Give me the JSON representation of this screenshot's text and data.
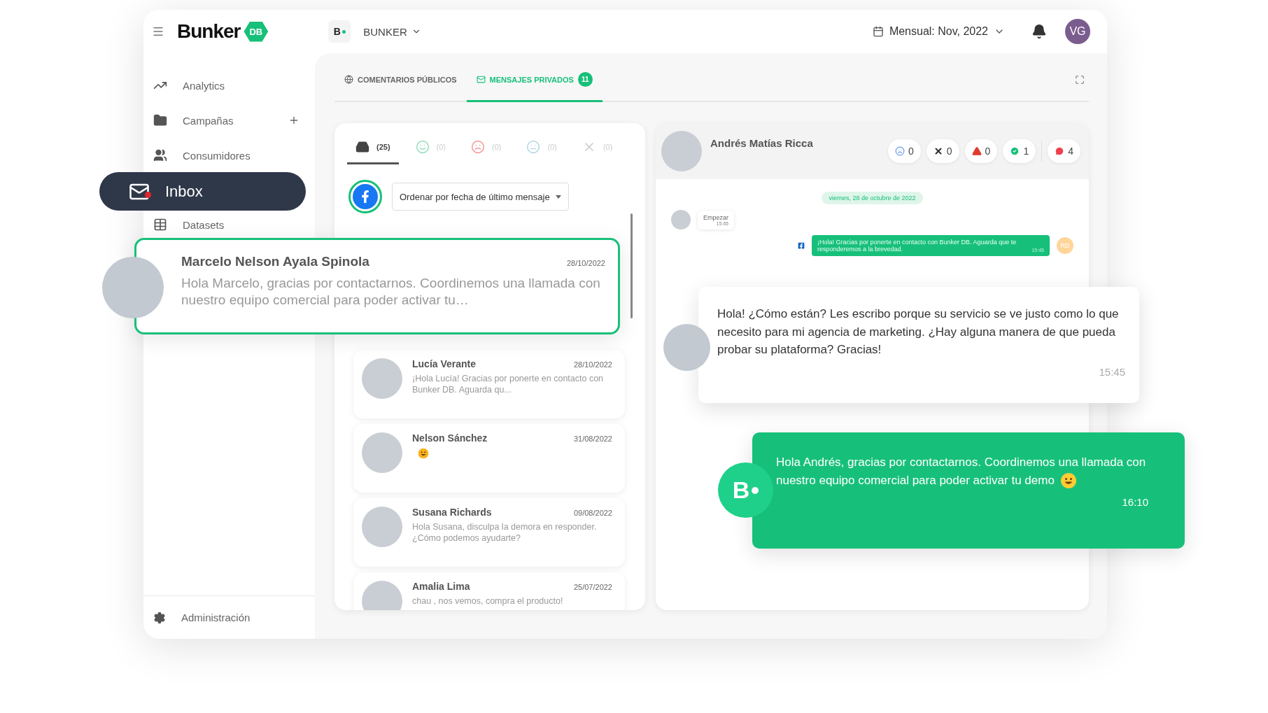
{
  "topbar": {
    "brand": "Bunker",
    "brand_badge": "DB",
    "workspace_logo": "B",
    "workspace": "BUNKER",
    "period": "Mensual: Nov, 2022",
    "avatar": "VG"
  },
  "sidebar": {
    "items": [
      {
        "kind": "analytics",
        "label": "Analytics",
        "selected": false
      },
      {
        "kind": "campaigns",
        "label": "Campañas",
        "selected": false,
        "addable": true
      },
      {
        "kind": "consumers",
        "label": "Consumidores",
        "selected": false
      },
      {
        "kind": "inbox",
        "label": "Inbox",
        "selected": true,
        "unread": true
      },
      {
        "kind": "datasets",
        "label": "Datasets",
        "selected": false
      }
    ],
    "footer": "Administración"
  },
  "tabs": [
    {
      "kind": "public",
      "label": "COMENTARIOS PÚBLICOS",
      "selected": false
    },
    {
      "kind": "private",
      "label": "MENSAJES PRIVADOS",
      "selected": true,
      "badge": "11"
    }
  ],
  "filters": [
    {
      "kind": "inbox",
      "count": "(25)",
      "selected": true
    },
    {
      "kind": "happy",
      "count": "(0)",
      "selected": false
    },
    {
      "kind": "sad",
      "count": "(0)",
      "selected": false
    },
    {
      "kind": "neutral",
      "count": "(0)",
      "selected": false
    },
    {
      "kind": "discarded",
      "count": "(0)",
      "selected": false
    }
  ],
  "sort": {
    "value": "Ordenar por fecha de último mensaje"
  },
  "conversations": [
    {
      "kind": "text",
      "name": "Marcelo Nelson Ayala Spinola",
      "date": "28/10/2022",
      "preview": "Hola Marcelo, gracias por contactarnos. Coordinemos una llamada con nuestro equipo comercial para poder activar tu…",
      "selected": true
    },
    {
      "kind": "text",
      "name": "Lucía Verante",
      "date": "28/10/2022",
      "preview": "¡Hola Lucía! Gracias por ponerte en contacto con Bunker DB. Aguarda qu...",
      "selected": false
    },
    {
      "kind": "sticker",
      "name": "Nelson Sánchez",
      "date": "31/08/2022",
      "selected": false
    },
    {
      "kind": "text",
      "name": "Susana Richards",
      "date": "09/08/2022",
      "preview": "Hola Susana, disculpa la demora en responder. ¿Cómo podemos ayudarte?",
      "selected": false
    },
    {
      "kind": "text",
      "name": "Amalia Lima",
      "date": "25/07/2022",
      "preview": "chau , nos vemos, compra el producto!",
      "selected": false
    }
  ],
  "chat": {
    "name": "Andrés Matías Ricca",
    "counters": [
      {
        "kind": "sad",
        "count": "0"
      },
      {
        "kind": "discarded",
        "count": "0"
      },
      {
        "kind": "alert",
        "count": "0"
      },
      {
        "kind": "approved",
        "count": "1"
      },
      {
        "kind": "comments",
        "count": "4"
      }
    ],
    "date_chip": "viernes, 28 de octubre de 2022",
    "messages": [
      {
        "kind": "incoming",
        "text": "Empezar",
        "time": "15:45"
      },
      {
        "kind": "outgoing",
        "text": "¡Hola! Gracias por ponerte en contacto con Bunker DB. Aguarda que te responderemos a la brevedad.",
        "time": "15:45",
        "avatar": "RD"
      }
    ]
  },
  "floating_messages": [
    {
      "kind": "incoming",
      "text": "Hola! ¿Cómo están? Les escribo porque su servicio se ve justo como lo que necesito para mi agencia de marketing. ¿Hay alguna manera de que pueda probar su plataforma? Gracias!",
      "time": "15:45",
      "emoji": false
    },
    {
      "kind": "outgoing",
      "text": "Hola Andrés, gracias por contactarnos. Coordinemos una llamada con nuestro equipo comercial para poder activar tu demo",
      "time": "16:10",
      "emoji": true,
      "logo": "B"
    }
  ]
}
